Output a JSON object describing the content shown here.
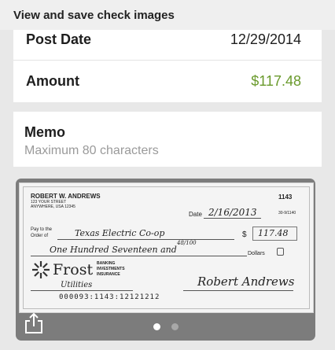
{
  "header": {
    "title": "View and save check images"
  },
  "details": [
    {
      "label": "Post Date",
      "value": "12/29/2014"
    },
    {
      "label": "Amount",
      "value": "$117.48",
      "color": "#6a9a2c"
    }
  ],
  "memo": {
    "label": "Memo",
    "placeholder": "Maximum 80 characters"
  },
  "check_image": {
    "payer_name": "ROBERT W. ANDREWS",
    "payer_address_1": "123 YOUR STREET",
    "payer_address_2": "ANYWHERE, USA 12345",
    "check_number": "1143",
    "routing_fraction": "30-9/1140",
    "date_label": "Date",
    "date_value": "2/16/2013",
    "pay_to_label_1": "Pay to the",
    "pay_to_label_2": "Order of",
    "payee": "Texas Electric Co-op",
    "dollar_sign": "$",
    "amount_numeric": "117.48",
    "amount_words": "One Hundred Seventeen and",
    "amount_cents": "48/100",
    "dollars_label": "Dollars",
    "bank_name": "Frost",
    "bank_tagline": [
      "BANKING",
      "INVESTMENTS",
      "INSURANCE"
    ],
    "memo_line": "Utilities",
    "signature": "Robert Andrews",
    "micr_line": "000093:1143:12121212"
  },
  "pager": {
    "page_count": 2,
    "current_page": 1
  },
  "icons": {
    "share": "share-icon"
  }
}
